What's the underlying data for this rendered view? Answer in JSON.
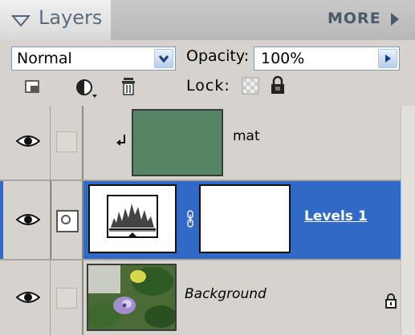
{
  "panel": {
    "title": "Layers",
    "more_label": "MORE"
  },
  "blend": {
    "mode": "Normal",
    "opacity_label": "Opacity:",
    "opacity_value": "100%"
  },
  "toolbar": {
    "lock_label": "Lock:",
    "icons": [
      "new-layer-icon",
      "adjustment-layer-icon",
      "trash-icon",
      "lock-transparency-icon",
      "lock-all-icon"
    ]
  },
  "layers": [
    {
      "name": "mat",
      "visible": true,
      "clipped": true,
      "selected": false,
      "fill_color": "#568566",
      "thumbnail": "solid-color-thumbnail"
    },
    {
      "name": "Levels 1",
      "visible": true,
      "selected": true,
      "adjustment": "levels",
      "has_mask": true,
      "thumbnail": "levels-icon"
    },
    {
      "name": "Background",
      "visible": true,
      "selected": false,
      "locked": true,
      "thumbnail": "flower-photo"
    }
  ],
  "colors": {
    "selected_row": "#3169c6",
    "mat_fill": "#568566",
    "title_text": "#5a6c7c"
  }
}
